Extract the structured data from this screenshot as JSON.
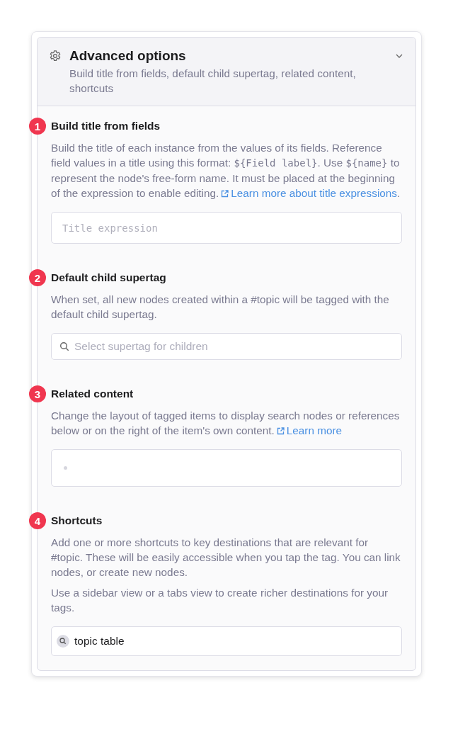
{
  "panel": {
    "title": "Advanced options",
    "subtitle": "Build title from fields, default child supertag, related content, shortcuts",
    "expanded": true
  },
  "sections": [
    {
      "number": "1",
      "title": "Build title from fields",
      "paragraphs": [
        [
          {
            "kind": "text",
            "text": "Build the title of each instance from the values of its fields. Reference field values in a title using this format: "
          },
          {
            "kind": "code",
            "text": "${Field label}"
          },
          {
            "kind": "text",
            "text": ". Use "
          },
          {
            "kind": "code",
            "text": "${name}"
          },
          {
            "kind": "text",
            "text": " to represent the node's free-form name. It must be placed at the beginning of the expression to enable editing."
          },
          {
            "kind": "link",
            "text": "Learn more about title expressions"
          },
          {
            "kind": "text",
            "text": "."
          }
        ]
      ],
      "field": {
        "kind": "code",
        "placeholder": "Title expression"
      }
    },
    {
      "number": "2",
      "title": "Default child supertag",
      "paragraphs": [
        [
          {
            "kind": "text",
            "text": "When set, all new nodes created within a #topic will be tagged with the default child supertag."
          }
        ]
      ],
      "field": {
        "kind": "search",
        "placeholder": "Select supertag for children"
      }
    },
    {
      "number": "3",
      "title": "Related content",
      "paragraphs": [
        [
          {
            "kind": "text",
            "text": "Change the layout of tagged items to display search nodes or references below or on the right of the item's own content."
          },
          {
            "kind": "link",
            "text": "Learn more"
          }
        ]
      ],
      "field": {
        "kind": "bullet"
      }
    },
    {
      "number": "4",
      "title": "Shortcuts",
      "paragraphs": [
        [
          {
            "kind": "text",
            "text": "Add one or more shortcuts to key destinations that are relevant for #topic. These will be easily accessible when you tap the tag. You can link nodes, or create new nodes."
          }
        ],
        [
          {
            "kind": "text",
            "text": "Use a sidebar view or a tabs view to create richer destinations for your tags."
          }
        ]
      ],
      "field": {
        "kind": "search-chip",
        "value": "topic table"
      }
    }
  ]
}
